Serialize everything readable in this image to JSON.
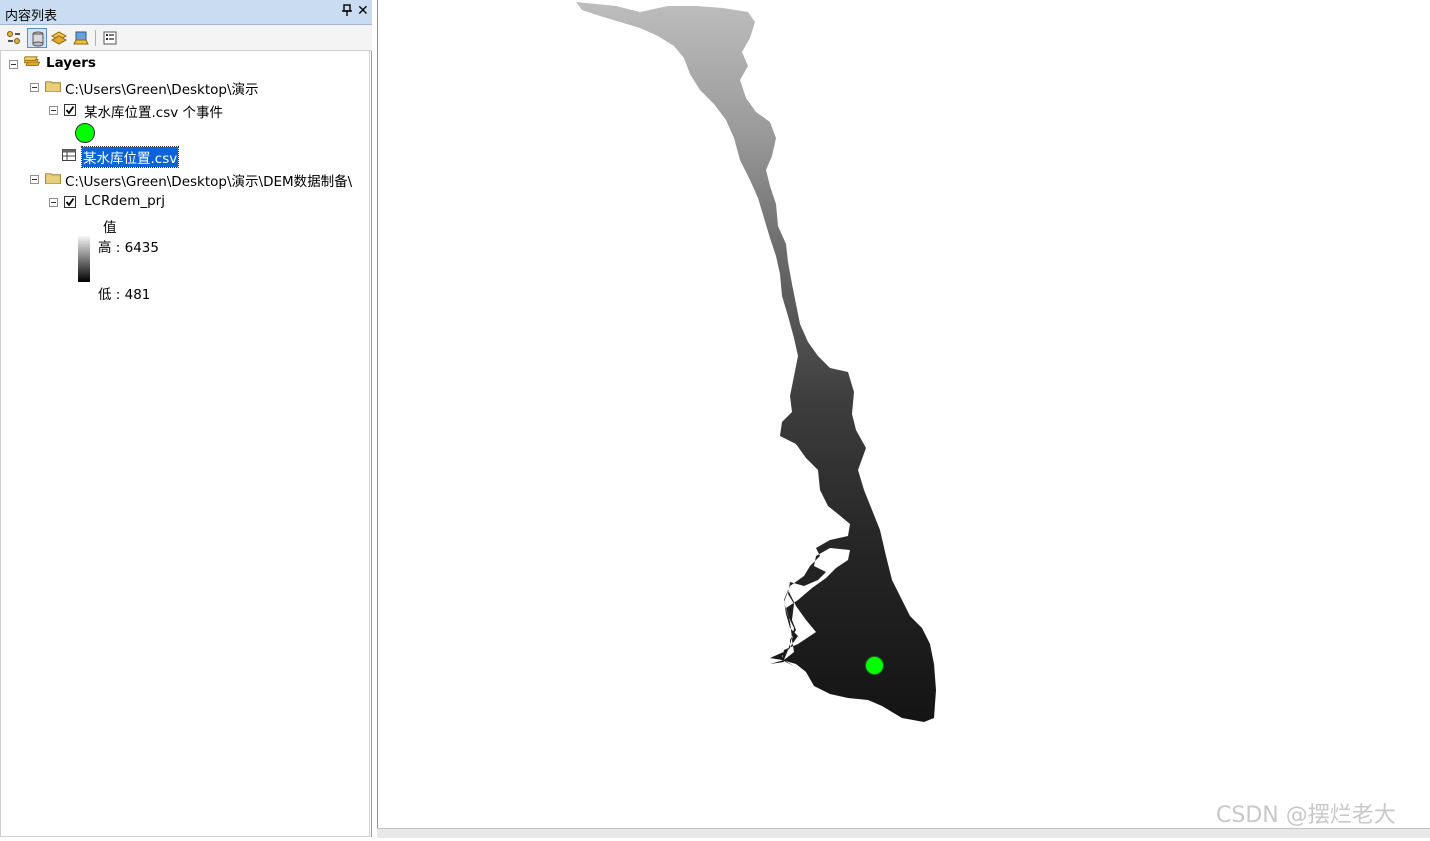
{
  "toc": {
    "title": "内容列表",
    "pin_label": "ᵽ",
    "close_label": "✕",
    "toolbar": [
      "list-by-drawing-order-icon",
      "list-by-source-icon",
      "list-by-visibility-icon",
      "list-by-selection-icon",
      "options-icon"
    ],
    "layers_label": "Layers",
    "group1": {
      "path": "C:\\Users\\Green\\Desktop\\演示",
      "event_layer": "某水库位置.csv 个事件",
      "event_symbol_color": "#00ff00",
      "table_name": "某水库位置.csv"
    },
    "group2": {
      "path": "C:\\Users\\Green\\Desktop\\演示\\DEM数据制备\\",
      "raster_layer": "LCRdem_prj",
      "legend_title": "值",
      "high_label": "高 : 6435",
      "low_label": "低 : 481"
    }
  },
  "map": {
    "point_color": "#00ff00"
  },
  "watermark": "CSDN @摆烂老大"
}
